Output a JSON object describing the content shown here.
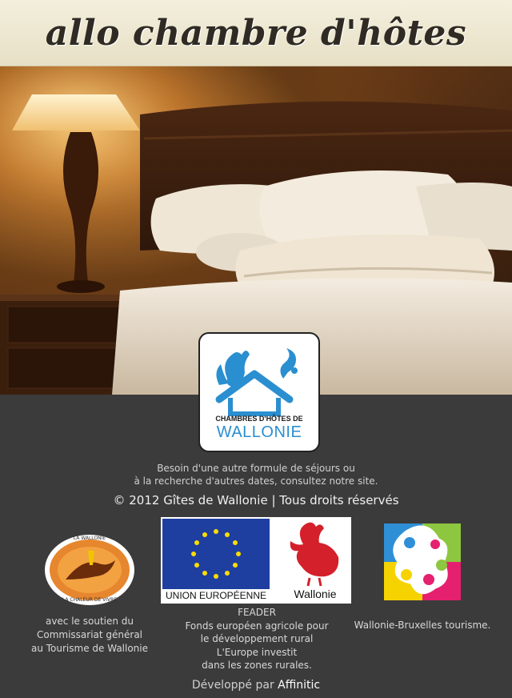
{
  "header": {
    "title": "allo chambre d'hôtes"
  },
  "logo": {
    "line1": "CHAMBRES D'HÔTES DE",
    "line2": "WALLONIE"
  },
  "footer": {
    "info_line1": "Besoin d'une autre formule de séjours ou",
    "info_line2": "à la recherche d'autres dates, consultez notre site.",
    "copyright": "© 2012 Gîtes de Wallonie | Tous droits réservés",
    "developer_prefix": "Développé par ",
    "developer_name": "Affinitic"
  },
  "partners": {
    "wallonie_seal": {
      "seal_top": "LA WALLONIE",
      "seal_bottom": "LA CHALEUR DE VIVRE",
      "caption": [
        "avec le soutien du",
        "Commissariat général",
        "au Tourisme de Wallonie"
      ]
    },
    "eu": {
      "eu_label": "UNION EUROPÉENNE",
      "wallonie_label": "Wallonie",
      "caption": [
        "FEADER",
        "Fonds européen agricole pour",
        "le développement rural",
        "L'Europe investit",
        "dans les zones rurales."
      ]
    },
    "wbt": {
      "caption": "Wallonie-Bruxelles tourisme."
    }
  },
  "colors": {
    "eu_blue": "#1f3fa0",
    "eu_star": "#ffdd00",
    "logo_blue": "#2a8fd0",
    "wallonie_red": "#d4202a"
  }
}
